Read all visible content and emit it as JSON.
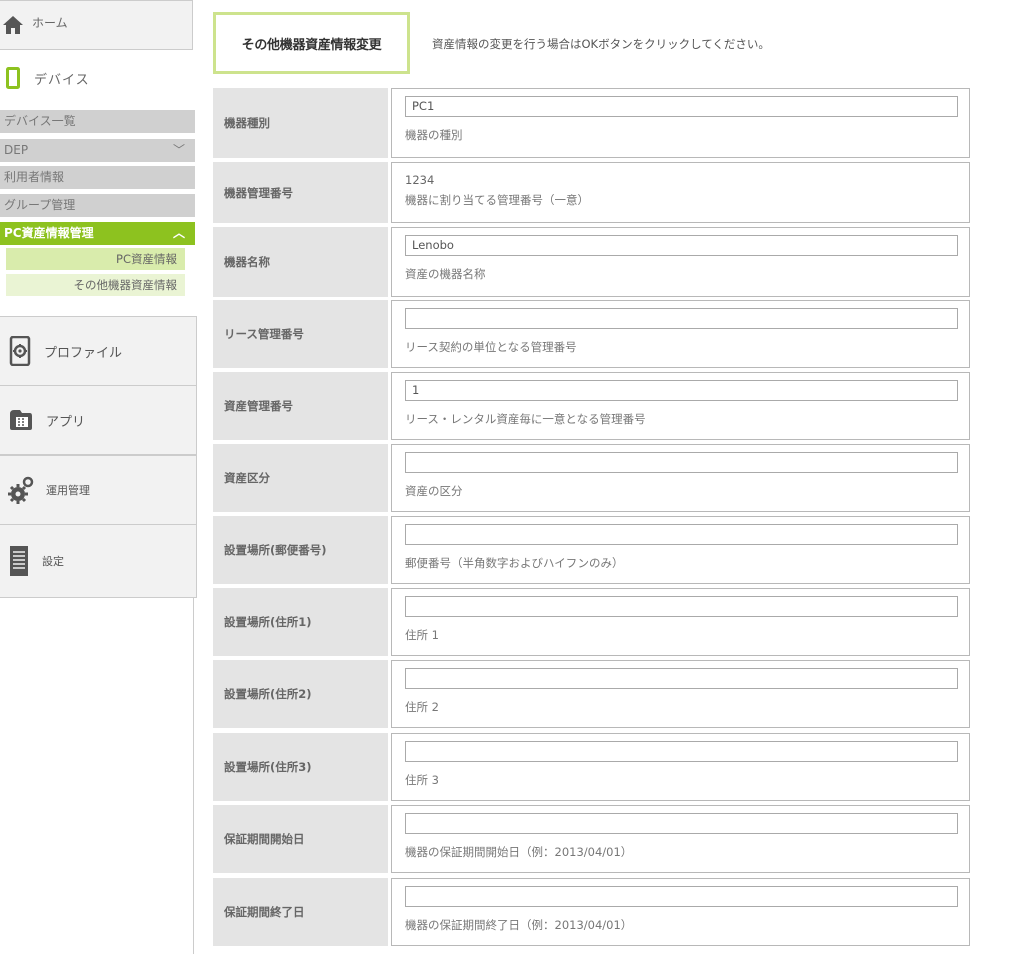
{
  "sidebar": {
    "home": {
      "label": "ホーム",
      "icon": "home-icon"
    },
    "device": {
      "label": "デバイス",
      "icon": "smartphone-icon",
      "accent": "#8dc21f"
    },
    "device_items": [
      {
        "label": "デバイス一覧"
      },
      {
        "label": "DEP",
        "chevron": "﹀"
      },
      {
        "label": "利用者情報"
      },
      {
        "label": "グループ管理"
      },
      {
        "label": "PC資産情報管理",
        "chevron": "︿",
        "active": true
      }
    ],
    "asset_items": [
      {
        "label": "PC資産情報"
      },
      {
        "label": "その他機器資産情報"
      }
    ],
    "nav": [
      {
        "label": "プロファイル",
        "icon": "profile-gear-icon"
      },
      {
        "label": "アプリ",
        "icon": "app-icon"
      },
      {
        "label": "運用管理",
        "icon": "gears-icon"
      },
      {
        "label": "設定",
        "icon": "settings-document-icon"
      }
    ]
  },
  "main": {
    "title": "その他機器資産情報変更",
    "instruction": "資産情報の変更を行う場合はOKボタンをクリックしてください。",
    "fields": [
      {
        "label": "機器種別",
        "type": "input",
        "value": "PC1",
        "hint": "機器の種別"
      },
      {
        "label": "機器管理番号",
        "type": "text",
        "value": "1234",
        "hint": "機器に割り当てる管理番号（一意）"
      },
      {
        "label": "機器名称",
        "type": "input",
        "value": "Lenobo",
        "hint": "資産の機器名称"
      },
      {
        "label": "リース管理番号",
        "type": "input",
        "value": "",
        "hint": "リース契約の単位となる管理番号"
      },
      {
        "label": "資産管理番号",
        "type": "input",
        "value": "1",
        "hint": "リース・レンタル資産毎に一意となる管理番号"
      },
      {
        "label": "資産区分",
        "type": "input",
        "value": "",
        "hint": "資産の区分"
      },
      {
        "label": "設置場所(郵便番号)",
        "type": "input",
        "value": "",
        "hint": "郵便番号（半角数字およびハイフンのみ）"
      },
      {
        "label": "設置場所(住所1)",
        "type": "input",
        "value": "",
        "hint": "住所 1"
      },
      {
        "label": "設置場所(住所2)",
        "type": "input",
        "value": "",
        "hint": "住所 2"
      },
      {
        "label": "設置場所(住所3)",
        "type": "input",
        "value": "",
        "hint": "住所 3"
      },
      {
        "label": "保証期間開始日",
        "type": "input",
        "value": "",
        "hint": "機器の保証期間開始日（例：2013/04/01）"
      },
      {
        "label": "保証期間終了日",
        "type": "input",
        "value": "",
        "hint": "機器の保証期間終了日（例：2013/04/01）"
      }
    ]
  }
}
